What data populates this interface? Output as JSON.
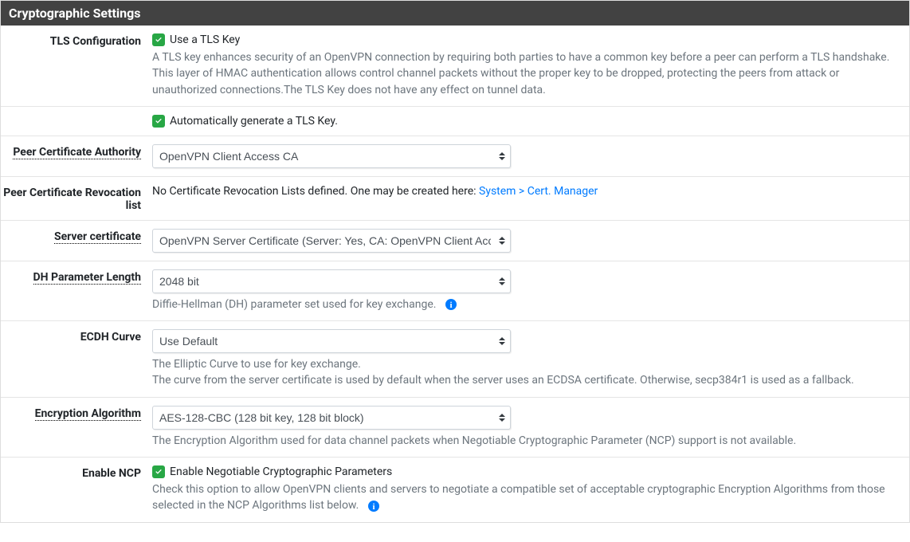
{
  "panel": {
    "title": "Cryptographic Settings"
  },
  "tls_config": {
    "label": "TLS Configuration",
    "checkbox_label": "Use a TLS Key",
    "help": "A TLS key enhances security of an OpenVPN connection by requiring both parties to have a common key before a peer can perform a TLS handshake. This layer of HMAC authentication allows control channel packets without the proper key to be dropped, protecting the peers from attack or unauthorized connections.The TLS Key does not have any effect on tunnel data."
  },
  "tls_autogen": {
    "checkbox_label": "Automatically generate a TLS Key."
  },
  "peer_ca": {
    "label": "Peer Certificate Authority",
    "selected": "OpenVPN Client Access CA"
  },
  "peer_crl": {
    "label": "Peer Certificate Revocation list",
    "text": "No Certificate Revocation Lists defined. One may be created here: ",
    "link": "System > Cert. Manager"
  },
  "server_cert": {
    "label": "Server certificate",
    "selected": "OpenVPN Server Certificate (Server: Yes, CA: OpenVPN Client Access CA)"
  },
  "dh": {
    "label": "DH Parameter Length",
    "selected": "2048 bit",
    "help": "Diffie-Hellman (DH) parameter set used for key exchange."
  },
  "ecdh": {
    "label": "ECDH Curve",
    "selected": "Use Default",
    "help1": "The Elliptic Curve to use for key exchange.",
    "help2": "The curve from the server certificate is used by default when the server uses an ECDSA certificate. Otherwise, secp384r1 is used as a fallback."
  },
  "enc_alg": {
    "label": "Encryption Algorithm",
    "selected": "AES-128-CBC (128 bit key, 128 bit block)",
    "help": "The Encryption Algorithm used for data channel packets when Negotiable Cryptographic Parameter (NCP) support is not available."
  },
  "ncp": {
    "label": "Enable NCP",
    "checkbox_label": "Enable Negotiable Cryptographic Parameters",
    "help": "Check this option to allow OpenVPN clients and servers to negotiate a compatible set of acceptable cryptographic Encryption Algorithms from those selected in the NCP Algorithms list below."
  }
}
